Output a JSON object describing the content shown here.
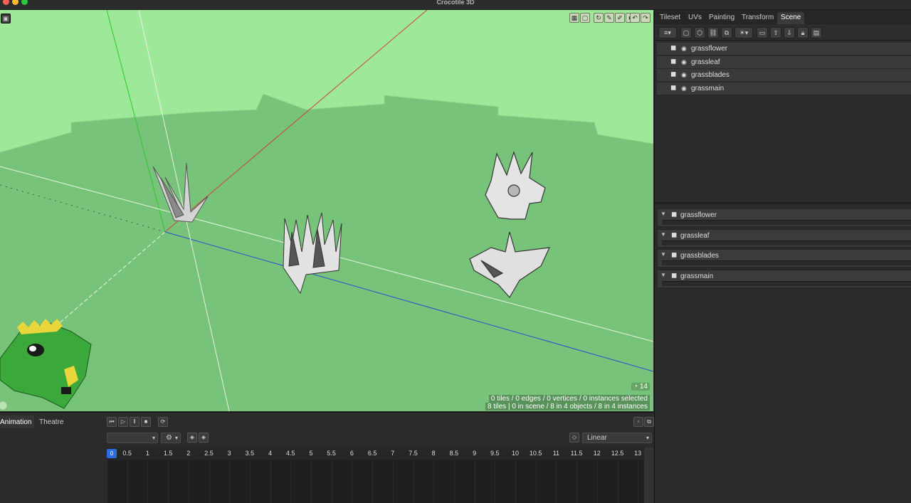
{
  "window": {
    "title": "Crocotile 3D"
  },
  "viewport": {
    "toolbar_icons": [
      "grid-icon",
      "cube-view-icon",
      "rotate-tool-icon",
      "paint-tool-icon",
      "eyedropper-icon",
      "solid-box-icon",
      "undo-icon",
      "redo-icon"
    ],
    "corner_icon": "image-icon",
    "undo_count": "14",
    "status_line_1": "0 tiles / 0 edges / 0 vertices / 0 instances selected",
    "status_line_2": "8 tiles | 0 in scene / 8 in 4 objects / 8 in 4 instances",
    "colors": {
      "sky": "#9ee89a",
      "ground": "#77c37a",
      "x_axis": "#d0403a",
      "y_axis": "#2ec82e",
      "z_axis": "#2a4bd0"
    }
  },
  "right_panel": {
    "tabs": [
      "Tileset",
      "UVs",
      "Painting",
      "Transform",
      "Scene"
    ],
    "active_tab": "Scene",
    "outliner": [
      {
        "label": "grassflower"
      },
      {
        "label": "grassleaf"
      },
      {
        "label": "grassblades"
      },
      {
        "label": "grassmain"
      }
    ],
    "layers": [
      {
        "label": "grassflower"
      },
      {
        "label": "grassleaf"
      },
      {
        "label": "grassblades"
      },
      {
        "label": "grassmain"
      }
    ]
  },
  "bottom_panel": {
    "tabs": [
      "Animation",
      "Theatre"
    ],
    "active_tab": "Animation",
    "interpolation": "Linear",
    "timeline_ticks": [
      "0",
      "0.5",
      "1",
      "1.5",
      "2",
      "2.5",
      "3",
      "3.5",
      "4",
      "4.5",
      "5",
      "5.5",
      "6",
      "6.5",
      "7",
      "7.5",
      "8",
      "8.5",
      "9",
      "9.5",
      "10",
      "10.5",
      "11",
      "11.5",
      "12",
      "12.5",
      "13"
    ]
  }
}
